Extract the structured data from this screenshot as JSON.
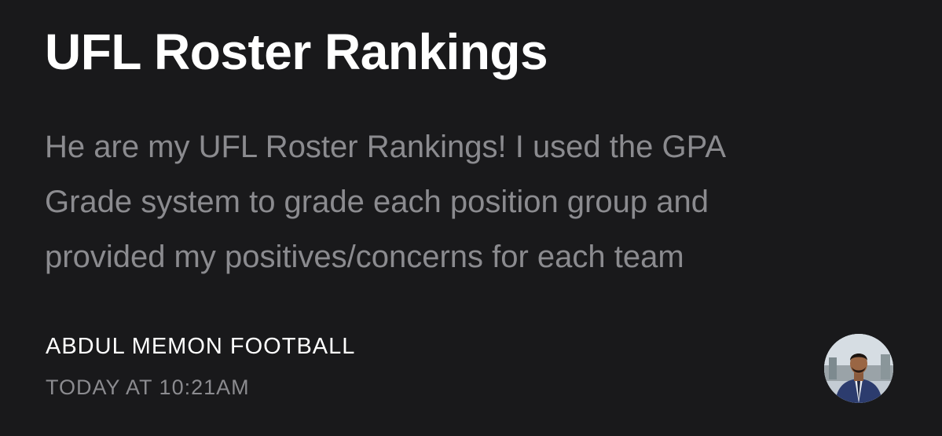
{
  "post": {
    "title": "UFL Roster Rankings",
    "description_lines": [
      "He are my UFL Roster Rankings! I used the GPA",
      "Grade system to grade each position group and",
      "provided my positives/concerns for each team"
    ],
    "author": "ABDUL MEMON FOOTBALL",
    "timestamp": "TODAY AT 10:21AM"
  },
  "colors": {
    "background": "#19191b",
    "title": "#ffffff",
    "secondary_text": "#8b8b8f"
  },
  "icons": {
    "avatar": "author-avatar-photo"
  }
}
